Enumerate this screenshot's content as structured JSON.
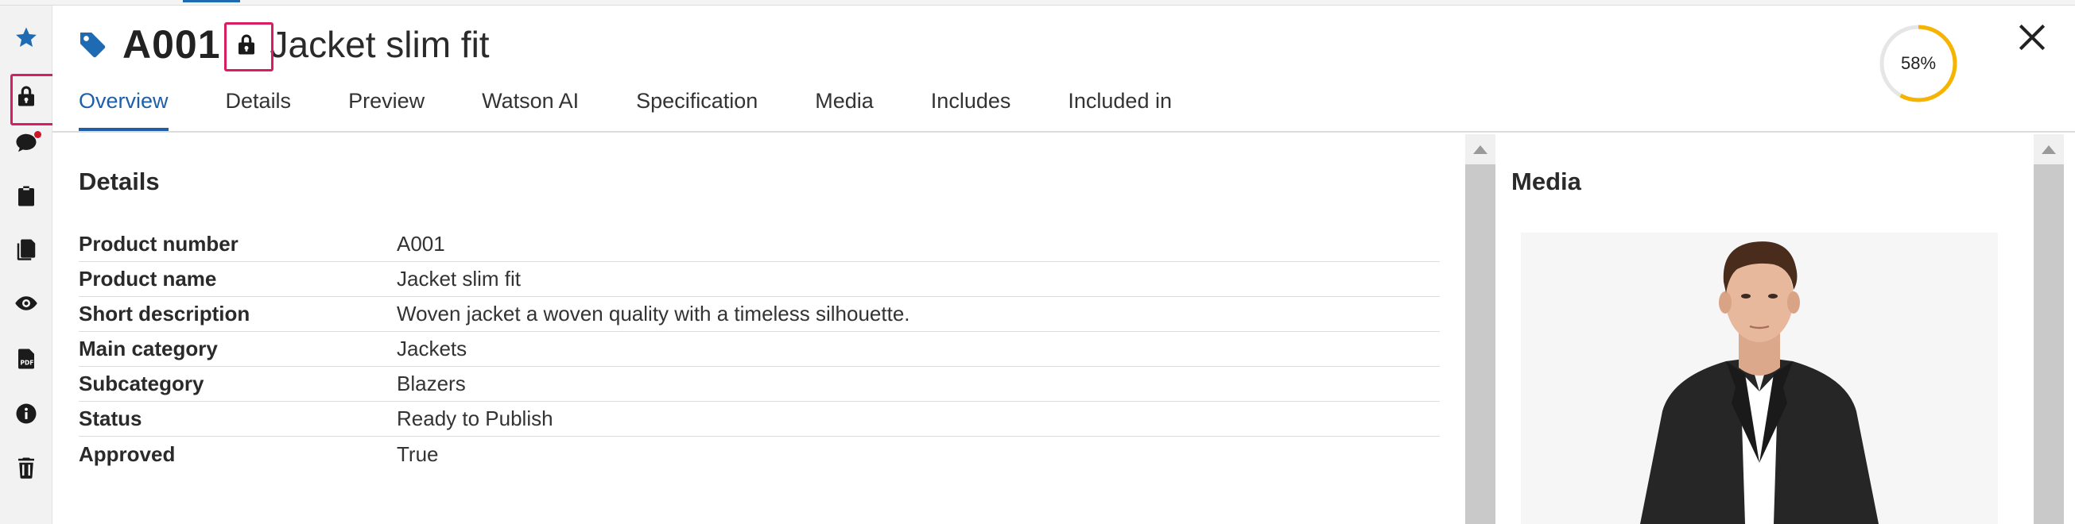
{
  "product": {
    "code": "A001",
    "name": "Jacket slim fit"
  },
  "tabs": [
    {
      "label": "Overview",
      "active": true
    },
    {
      "label": "Details",
      "active": false
    },
    {
      "label": "Preview",
      "active": false
    },
    {
      "label": "Watson AI",
      "active": false
    },
    {
      "label": "Specification",
      "active": false
    },
    {
      "label": "Media",
      "active": false
    },
    {
      "label": "Includes",
      "active": false
    },
    {
      "label": "Included in",
      "active": false
    }
  ],
  "completeness": {
    "label": "58%",
    "value": 0.58,
    "color": "#f5b400"
  },
  "details": {
    "title": "Details",
    "rows": [
      {
        "label": "Product number",
        "value": "A001"
      },
      {
        "label": "Product name",
        "value": "Jacket slim fit"
      },
      {
        "label": "Short description",
        "value": "Woven jacket a woven quality with a timeless silhouette."
      },
      {
        "label": "Main category",
        "value": "Jackets"
      },
      {
        "label": "Subcategory",
        "value": "Blazers"
      },
      {
        "label": "Status",
        "value": "Ready to Publish"
      },
      {
        "label": "Approved",
        "value": "True"
      }
    ]
  },
  "media": {
    "title": "Media"
  },
  "rail": [
    "star-icon",
    "lock-icon",
    "comment-icon",
    "clipboard-icon",
    "documents-icon",
    "eye-icon",
    "pdf-icon",
    "info-icon",
    "trash-icon"
  ],
  "colors": {
    "accent": "#1f5fa8",
    "highlight": "#d81d62",
    "notification": "#d0142c"
  }
}
